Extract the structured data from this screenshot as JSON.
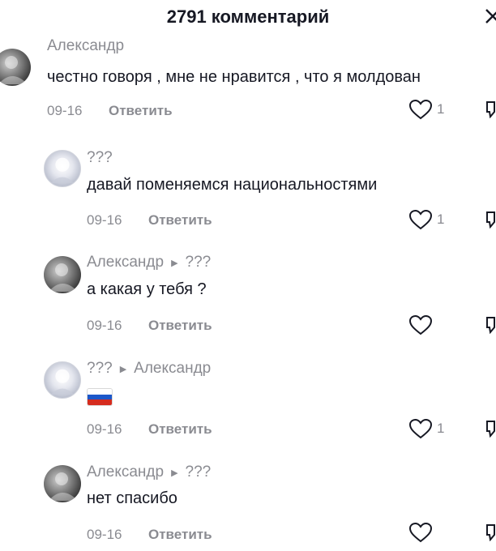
{
  "header": {
    "title": "2791 комментарий"
  },
  "comments": [
    {
      "author": "Александр",
      "text": "честно говоря , мне не нравится , что я молдован",
      "date": "09-16",
      "reply_label": "Ответить",
      "likes": "1"
    },
    {
      "author": "???",
      "text": "давай поменяемся национальностями",
      "date": "09-16",
      "reply_label": "Ответить",
      "likes": "1"
    },
    {
      "author": "Александр",
      "reply_to": "???",
      "text": "а какая у тебя ?",
      "date": "09-16",
      "reply_label": "Ответить",
      "likes": ""
    },
    {
      "author": "???",
      "reply_to": "Александр",
      "text": "",
      "emoji": "russia-flag",
      "date": "09-16",
      "reply_label": "Ответить",
      "likes": "1"
    },
    {
      "author": "Александр",
      "reply_to": "???",
      "text": "нет спасибо",
      "date": "09-16",
      "reply_label": "Ответить",
      "likes": ""
    }
  ],
  "icons": {
    "close": "close-icon",
    "like": "heart-outline-icon",
    "dislike": "thumb-down-icon",
    "reply_arrow": "triangle-right-icon"
  },
  "colors": {
    "text": "#161823",
    "secondary": "#8a8b91",
    "background": "#ffffff"
  }
}
